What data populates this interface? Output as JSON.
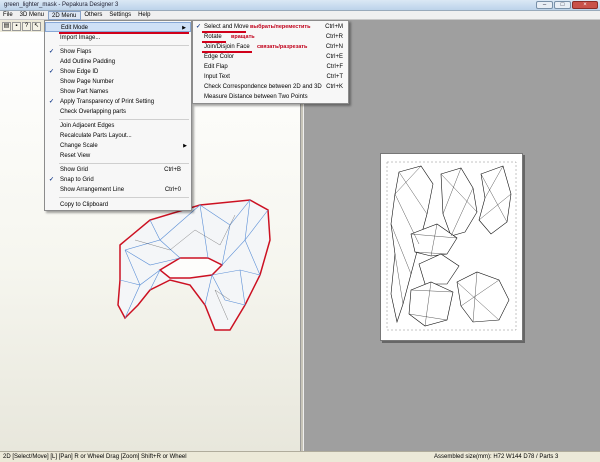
{
  "window": {
    "title": "green_lighter_mask - Pepakura Designer 3"
  },
  "menubar": [
    {
      "label": "File"
    },
    {
      "label": "3D Menu"
    },
    {
      "label": "2D Menu",
      "active": true
    },
    {
      "label": "Others"
    },
    {
      "label": "Settings"
    },
    {
      "label": "Help"
    }
  ],
  "menu_2d": {
    "items": [
      {
        "label": "Edit Mode",
        "submenu": true,
        "highlighted": true
      },
      {
        "label": "Import Image..."
      },
      {
        "sep": true
      },
      {
        "label": "Show Flaps",
        "checked": true
      },
      {
        "label": "Add Outline Padding"
      },
      {
        "label": "Show Edge ID",
        "checked": true
      },
      {
        "label": "Show Page Number"
      },
      {
        "label": "Show Part Names"
      },
      {
        "label": "Apply Transparency of Print Setting",
        "checked": true
      },
      {
        "label": "Check Overlapping parts"
      },
      {
        "sep": true
      },
      {
        "label": "Join Adjacent Edges"
      },
      {
        "label": "Recalculate Parts Layout..."
      },
      {
        "label": "Change Scale",
        "submenu": true
      },
      {
        "label": "Reset View"
      },
      {
        "sep": true
      },
      {
        "label": "Show Grid",
        "shortcut": "Ctrl+B"
      },
      {
        "label": "Snap to Grid",
        "checked": true
      },
      {
        "label": "Show Arrangement Line",
        "shortcut": "Ctrl+0"
      },
      {
        "sep": true
      },
      {
        "label": "Copy to Clipboard"
      }
    ]
  },
  "submenu_edit_mode": {
    "items": [
      {
        "label": "Select and Move",
        "shortcut": "Ctrl+M",
        "checked": true,
        "annotation": "выбрать/переместить"
      },
      {
        "label": "Rotate",
        "shortcut": "Ctrl+R",
        "annotation": "вращать"
      },
      {
        "label": "Join/Disjoin Face",
        "shortcut": "Ctrl+N",
        "annotation": "связать/разрезать"
      },
      {
        "label": "Edge Color",
        "shortcut": "Ctrl+E"
      },
      {
        "label": "Edit Flap",
        "shortcut": "Ctrl+F"
      },
      {
        "label": "Input Text",
        "shortcut": "Ctrl+T"
      },
      {
        "label": "Check Correspondence between 2D and 3D",
        "shortcut": "Ctrl+K"
      },
      {
        "label": "Measure Distance between Two Points",
        "shortcut": ""
      }
    ]
  },
  "statusbar": {
    "left": "2D [Select/Move] [L] [Pan] R or Wheel Drag [Zoom] Shift+R or Wheel",
    "right": "Assembled size(mm): H72 W144 D78 / Parts 3"
  },
  "colors": {
    "annotation_red": "#d0001a",
    "outline_red": "#cc1122",
    "mesh_blue": "#5b8fd6",
    "canvas_gray": "#9f9f9f"
  },
  "icons": [
    "open-icon",
    "save-icon",
    "help-icon",
    "select-icon"
  ]
}
